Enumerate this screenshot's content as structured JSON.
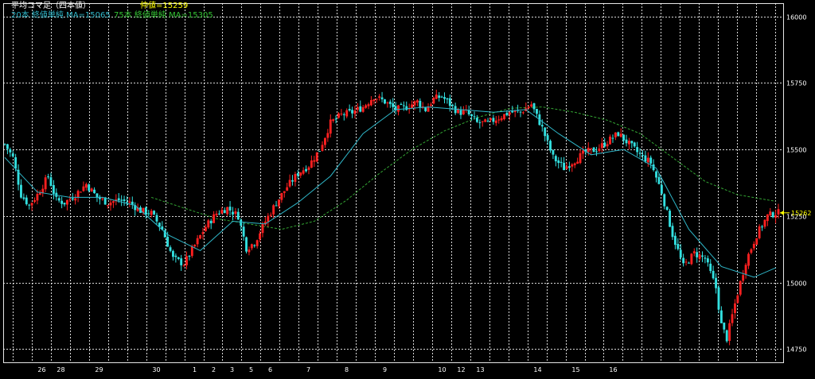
{
  "header": {
    "title": "平均コマ足（四本値）",
    "mid_price": "仲値=15259",
    "ma20": "20本 終値単純 MA=15065",
    "ma75": "75本 終値単純 MA=15305"
  },
  "colors": {
    "background": "#000000",
    "grid": "#ffffff",
    "bull": "#ff2020",
    "bear": "#33e0e0",
    "ma20": "#2fb7c9",
    "ma75": "#33a533",
    "title": "#ffffff",
    "mid_price": "#ffff00",
    "price_marker": "#ffff00"
  },
  "chart_data": {
    "type": "candlestick",
    "ylim": [
      14700,
      16050
    ],
    "y_ticks": [
      14750,
      15000,
      15250,
      15500,
      15750,
      16000
    ],
    "x_ticks": [
      "26",
      "28",
      "29",
      "30",
      "1",
      "2",
      "3",
      "5",
      "6",
      "7",
      "8",
      "9",
      "10",
      "12",
      "13",
      "14",
      "15",
      "16"
    ],
    "last_price_label": "15262",
    "last_price": 15262,
    "close_path": [
      [
        0,
        15520
      ],
      [
        3,
        15470
      ],
      [
        6,
        15330
      ],
      [
        9,
        15290
      ],
      [
        12,
        15330
      ],
      [
        16,
        15400
      ],
      [
        19,
        15310
      ],
      [
        22,
        15300
      ],
      [
        26,
        15330
      ],
      [
        30,
        15370
      ],
      [
        34,
        15320
      ],
      [
        38,
        15300
      ],
      [
        42,
        15310
      ],
      [
        46,
        15300
      ],
      [
        50,
        15270
      ],
      [
        54,
        15260
      ],
      [
        58,
        15200
      ],
      [
        62,
        15090
      ],
      [
        66,
        15070
      ],
      [
        70,
        15140
      ],
      [
        74,
        15210
      ],
      [
        78,
        15260
      ],
      [
        82,
        15280
      ],
      [
        86,
        15250
      ],
      [
        89,
        15130
      ],
      [
        92,
        15150
      ],
      [
        96,
        15230
      ],
      [
        100,
        15300
      ],
      [
        104,
        15360
      ],
      [
        108,
        15410
      ],
      [
        112,
        15440
      ],
      [
        116,
        15500
      ],
      [
        120,
        15600
      ],
      [
        124,
        15630
      ],
      [
        128,
        15640
      ],
      [
        132,
        15660
      ],
      [
        136,
        15700
      ],
      [
        140,
        15680
      ],
      [
        144,
        15650
      ],
      [
        148,
        15660
      ],
      [
        152,
        15680
      ],
      [
        155,
        15650
      ],
      [
        158,
        15690
      ],
      [
        161,
        15700
      ],
      [
        164,
        15670
      ],
      [
        167,
        15640
      ],
      [
        170,
        15640
      ],
      [
        174,
        15600
      ],
      [
        178,
        15600
      ],
      [
        182,
        15620
      ],
      [
        186,
        15640
      ],
      [
        190,
        15640
      ],
      [
        194,
        15670
      ],
      [
        198,
        15580
      ],
      [
        202,
        15470
      ],
      [
        206,
        15430
      ],
      [
        210,
        15460
      ],
      [
        214,
        15490
      ],
      [
        218,
        15500
      ],
      [
        222,
        15530
      ],
      [
        226,
        15560
      ],
      [
        230,
        15520
      ],
      [
        234,
        15480
      ],
      [
        238,
        15450
      ],
      [
        242,
        15340
      ],
      [
        246,
        15180
      ],
      [
        250,
        15060
      ],
      [
        254,
        15110
      ],
      [
        258,
        15090
      ],
      [
        262,
        14980
      ],
      [
        264,
        14840
      ],
      [
        266,
        14790
      ],
      [
        269,
        14920
      ],
      [
        273,
        15080
      ],
      [
        277,
        15180
      ],
      [
        281,
        15250
      ],
      [
        284,
        15262
      ]
    ],
    "ma20": [
      [
        0,
        15470
      ],
      [
        12,
        15340
      ],
      [
        24,
        15320
      ],
      [
        36,
        15320
      ],
      [
        48,
        15290
      ],
      [
        60,
        15180
      ],
      [
        72,
        15120
      ],
      [
        84,
        15230
      ],
      [
        96,
        15220
      ],
      [
        108,
        15300
      ],
      [
        120,
        15400
      ],
      [
        132,
        15560
      ],
      [
        144,
        15650
      ],
      [
        156,
        15660
      ],
      [
        168,
        15650
      ],
      [
        180,
        15640
      ],
      [
        192,
        15650
      ],
      [
        204,
        15560
      ],
      [
        216,
        15480
      ],
      [
        228,
        15500
      ],
      [
        240,
        15430
      ],
      [
        252,
        15200
      ],
      [
        264,
        15060
      ],
      [
        276,
        15020
      ],
      [
        284,
        15055
      ]
    ],
    "ma75": [
      [
        54,
        15320
      ],
      [
        66,
        15280
      ],
      [
        78,
        15240
      ],
      [
        90,
        15220
      ],
      [
        102,
        15200
      ],
      [
        114,
        15230
      ],
      [
        126,
        15310
      ],
      [
        138,
        15410
      ],
      [
        150,
        15500
      ],
      [
        162,
        15570
      ],
      [
        174,
        15620
      ],
      [
        186,
        15655
      ],
      [
        198,
        15660
      ],
      [
        210,
        15640
      ],
      [
        222,
        15610
      ],
      [
        234,
        15560
      ],
      [
        246,
        15470
      ],
      [
        258,
        15380
      ],
      [
        270,
        15330
      ],
      [
        284,
        15305
      ]
    ]
  }
}
